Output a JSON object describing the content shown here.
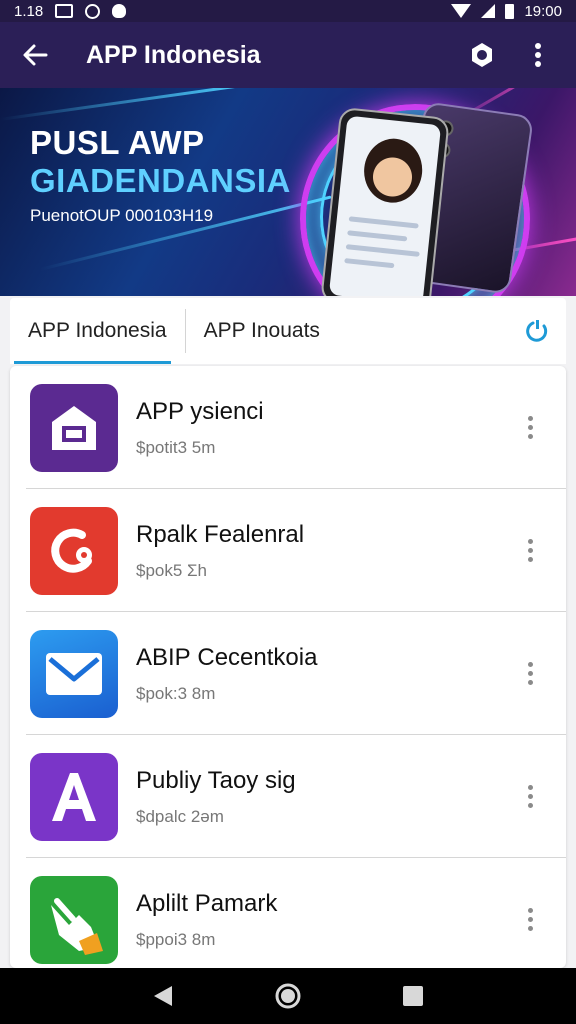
{
  "status_bar": {
    "time_left": "1.18",
    "time": "19:00"
  },
  "app_bar": {
    "title": "APP Indonesia"
  },
  "banner": {
    "title_line1": "PUSL AWP",
    "title_line2": "GIADENDANSIA",
    "subtitle": "PuenotOUP 000103H19"
  },
  "tabs": [
    {
      "label": "APP Indonesia",
      "active": true
    },
    {
      "label": "APP Inouats",
      "active": false
    }
  ],
  "apps": [
    {
      "name": "APP ysienci",
      "meta": "$potit3 5m",
      "icon": "house-icon",
      "color": "#5b2a91"
    },
    {
      "name": "Rpalk Fealenral",
      "meta": "$pok5 Σh",
      "icon": "phone-icon",
      "color": "#e23a2e"
    },
    {
      "name": "ΑBIР Cecentkoia",
      "meta": "$pok:3 8m",
      "icon": "mail-icon",
      "color": "#1a6fd8"
    },
    {
      "name": "Publiy Taoy sig",
      "meta": "$dpalc 2әm",
      "icon": "letter-a-icon",
      "color": "#7a35c8"
    },
    {
      "name": "Aplilt Pamark",
      "meta": "$ppoi3 8m",
      "icon": "hand-icon",
      "color": "#2aa53a"
    }
  ],
  "colors": {
    "app_bar": "#2b1f57",
    "status_bar": "#241a45",
    "tab_indicator": "#1e9ad6",
    "refresh_icon": "#1e9ad6"
  }
}
